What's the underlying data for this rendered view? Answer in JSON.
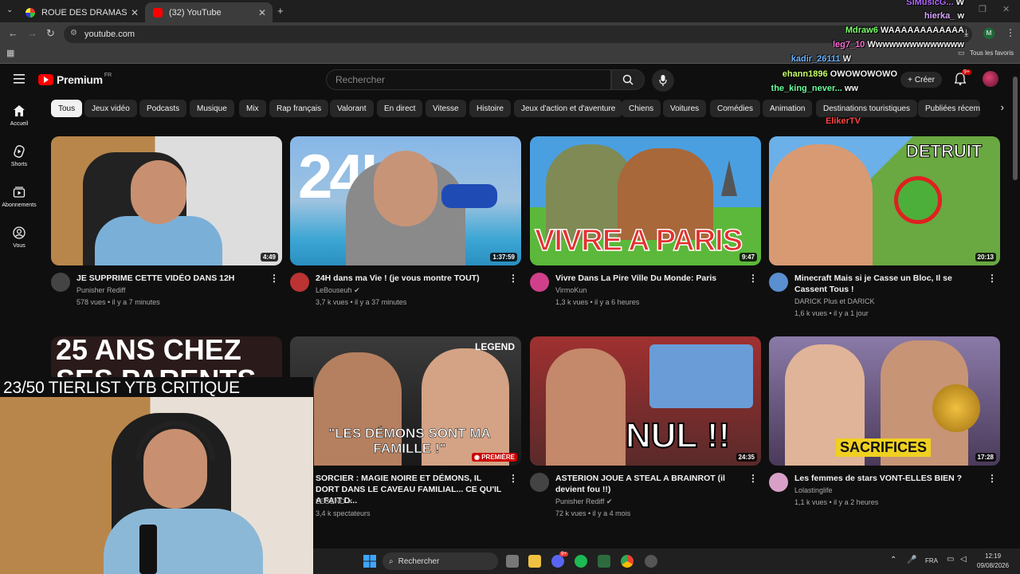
{
  "browser": {
    "tabs": [
      {
        "label": "ROUE DES DRAMAS",
        "active": false
      },
      {
        "label": "(32) YouTube",
        "active": true
      }
    ],
    "address": "youtube.com",
    "bookmarks_label": "Tous les favoris"
  },
  "youtube": {
    "logo_text": "Premium",
    "country_code": "FR",
    "search_placeholder": "Rechercher",
    "create_label": "Créer",
    "notification_count": "9+",
    "sidebar": [
      {
        "label": "Accueil",
        "icon": "home-icon"
      },
      {
        "label": "Shorts",
        "icon": "shorts-icon"
      },
      {
        "label": "Abonnements",
        "icon": "subscriptions-icon"
      },
      {
        "label": "Vous",
        "icon": "you-icon"
      }
    ],
    "chips": [
      "Tous",
      "Jeux vidéo",
      "Podcasts",
      "Musique",
      "Mix",
      "Rap français",
      "Valorant",
      "En direct",
      "Vitesse",
      "Histoire",
      "Jeux d'action et d'aventure",
      "Chiens",
      "Voitures",
      "Comédies",
      "Animation",
      "Destinations touristiques",
      "Publiées récem"
    ],
    "videos": [
      {
        "title": "JE SUPPRIME CETTE VIDÉO DANS 12H",
        "channel": "Punisher Rediff",
        "verified": false,
        "meta": "578 vues • il y a 7 minutes",
        "duration": "4:49"
      },
      {
        "title": "24H dans ma Vie ! (je vous montre TOUT)",
        "channel": "LeBouseuh",
        "verified": true,
        "meta": "3,7 k vues • il y a 37 minutes",
        "duration": "1:37:59",
        "thumb_text": "24H"
      },
      {
        "title": "Vivre Dans La Pire Ville Du Monde: Paris",
        "channel": "VirmoKun",
        "verified": false,
        "meta": "1,3 k vues • il y a 6 heures",
        "duration": "9:47",
        "thumb_text": "VIVRE A PARIS"
      },
      {
        "title": "Minecraft Mais si je Casse un Bloc, Il se Cassent Tous !",
        "channel": "DARICK Plus et DARICK",
        "verified": false,
        "meta": "1,6 k vues • il y a 1 jour",
        "duration": "20:13",
        "thumb_text": "DETRUIT"
      },
      {
        "title": "",
        "channel": "",
        "verified": false,
        "meta": "",
        "duration": "",
        "thumb_text": "25 ANS CHEZ SES PARENTS"
      },
      {
        "title": "SORCIER : MAGIE NOIRE ET DÉMONS, IL DORT DANS LE CAVEAU FAMILIAL... CE QU'IL A FAIT D...",
        "channel": "LEGEND",
        "verified": true,
        "meta": "3,4 k spectateurs",
        "duration": "",
        "badge": "PREMIÈRE",
        "thumb_text": "\"LES DÉMONS SONT MA FAMILLE !\"",
        "thumb_tag": "LEGEND"
      },
      {
        "title": "ASTERION JOUE A STEAL A BRAINROT (il devient fou !!)",
        "channel": "Punisher Rediff",
        "verified": true,
        "meta": "72 k vues • il y a 4 mois",
        "duration": "24:35",
        "thumb_text": "NUL !!"
      },
      {
        "title": "Les femmes de stars VONT-ELLES BIEN ?",
        "channel": "Lolastinglife",
        "verified": false,
        "meta": "1,1 k vues • il y a 2 heures",
        "duration": "17:28",
        "thumb_text": "SACRIFICES"
      }
    ]
  },
  "overlay": {
    "chat": [
      {
        "user": "SIMusicG...",
        "msg": "W",
        "color": "#b36bff"
      },
      {
        "user": "hierka_",
        "msg": "w",
        "color": "#d9a6ff"
      },
      {
        "user": "Mdraw6",
        "msg": "WAAAAAAAAAAAA",
        "color": "#7cff6b"
      },
      {
        "user": "leg7_10",
        "msg": "Wwwwwwwwwwwwww",
        "color": "#ff6bd5"
      },
      {
        "user": "kadir_26111",
        "msg": "W",
        "color": "#6bb4ff"
      },
      {
        "user": "ehann1896",
        "msg": "OWOWOWOWO",
        "color": "#c8ff6b"
      },
      {
        "user": "the_king_never...",
        "msg": "ww",
        "color": "#6bff9e"
      },
      {
        "user": "",
        "msg": "",
        "color": "#b36bff"
      },
      {
        "user": "ElikerTV",
        "msg": "",
        "color": "#ff4545"
      }
    ],
    "tierlist_banner": "23/50 TIERLIST YTB CRITIQUE"
  },
  "taskbar": {
    "search_placeholder": "Rechercher",
    "language": "FRA",
    "time": "12:19",
    "date": "09/08/2026",
    "discord_badge": "9+"
  }
}
